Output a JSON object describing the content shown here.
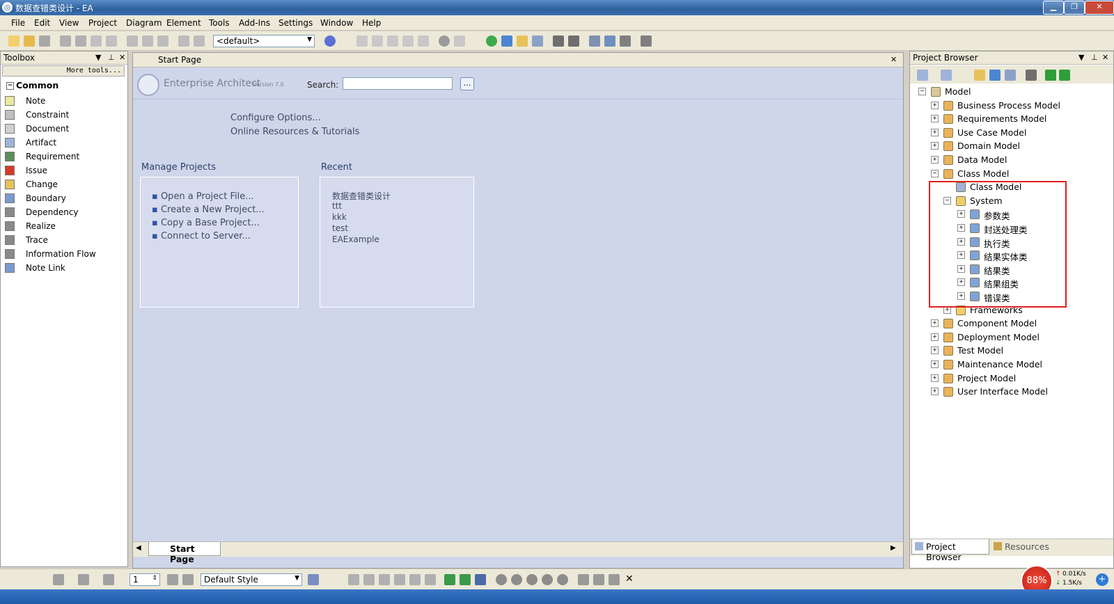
{
  "window": {
    "title": "数据查错类设计 - EA"
  },
  "menu": [
    "File",
    "Edit",
    "View",
    "Project",
    "Diagram",
    "Element",
    "Tools",
    "Add-Ins",
    "Settings",
    "Window",
    "Help"
  ],
  "toolbar": {
    "workspace": "<default>"
  },
  "toolbox": {
    "title": "Toolbox",
    "more_tools": "More tools...",
    "section": "Common",
    "items": [
      {
        "label": "Note",
        "icon": "note-icon"
      },
      {
        "label": "Constraint",
        "icon": "constraint-icon"
      },
      {
        "label": "Document",
        "icon": "document-icon"
      },
      {
        "label": "Artifact",
        "icon": "artifact-icon"
      },
      {
        "label": "Requirement",
        "icon": "requirement-icon"
      },
      {
        "label": "Issue",
        "icon": "issue-icon"
      },
      {
        "label": "Change",
        "icon": "change-icon"
      },
      {
        "label": "Boundary",
        "icon": "boundary-icon"
      },
      {
        "label": "Dependency",
        "icon": "dependency-icon"
      },
      {
        "label": "Realize",
        "icon": "realize-icon"
      },
      {
        "label": "Trace",
        "icon": "trace-icon"
      },
      {
        "label": "Information Flow",
        "icon": "information-flow-icon"
      },
      {
        "label": "Note Link",
        "icon": "note-link-icon"
      }
    ]
  },
  "startpage": {
    "tab_title": "Start Page",
    "product": "Enterprise Architect",
    "version": "Version 7.0",
    "search_label": "Search:",
    "search_value": "",
    "search_button": "...",
    "links": [
      "Configure Options...",
      "Online Resources & Tutorials"
    ],
    "manage": {
      "title": "Manage Projects",
      "items": [
        "Open a Project File...",
        "Create a New Project...",
        "Copy a Base Project...",
        "Connect to Server..."
      ]
    },
    "recent": {
      "title": "Recent",
      "items": [
        "数据查错类设计",
        "ttt",
        "kkk",
        "test",
        "EAExample"
      ]
    },
    "bottom_tab": "Start Page"
  },
  "browser": {
    "title": "Project Browser",
    "tabs": [
      "Project Browser",
      "Resources"
    ],
    "root": "Model",
    "models_top": [
      "Business Process Model",
      "Requirements Model",
      "Use Case Model",
      "Domain Model",
      "Data Model",
      "Class Model"
    ],
    "class_model_children": {
      "diagram": "Class Model",
      "package": "System",
      "items": [
        "参数类",
        "封送处理类",
        "执行类",
        "结果实体类",
        "结果类",
        "结果组类",
        "错误类"
      ],
      "next": "Frameworks"
    },
    "models_bottom": [
      "Component Model",
      "Deployment Model",
      "Test Model",
      "Maintenance Model",
      "Project Model",
      "User Interface Model"
    ]
  },
  "statusbar": {
    "zoom_value": "1",
    "style": "Default Style"
  },
  "tray": {
    "cpu": "88%",
    "up": "0.01K/s",
    "down": "1.5K/s"
  }
}
